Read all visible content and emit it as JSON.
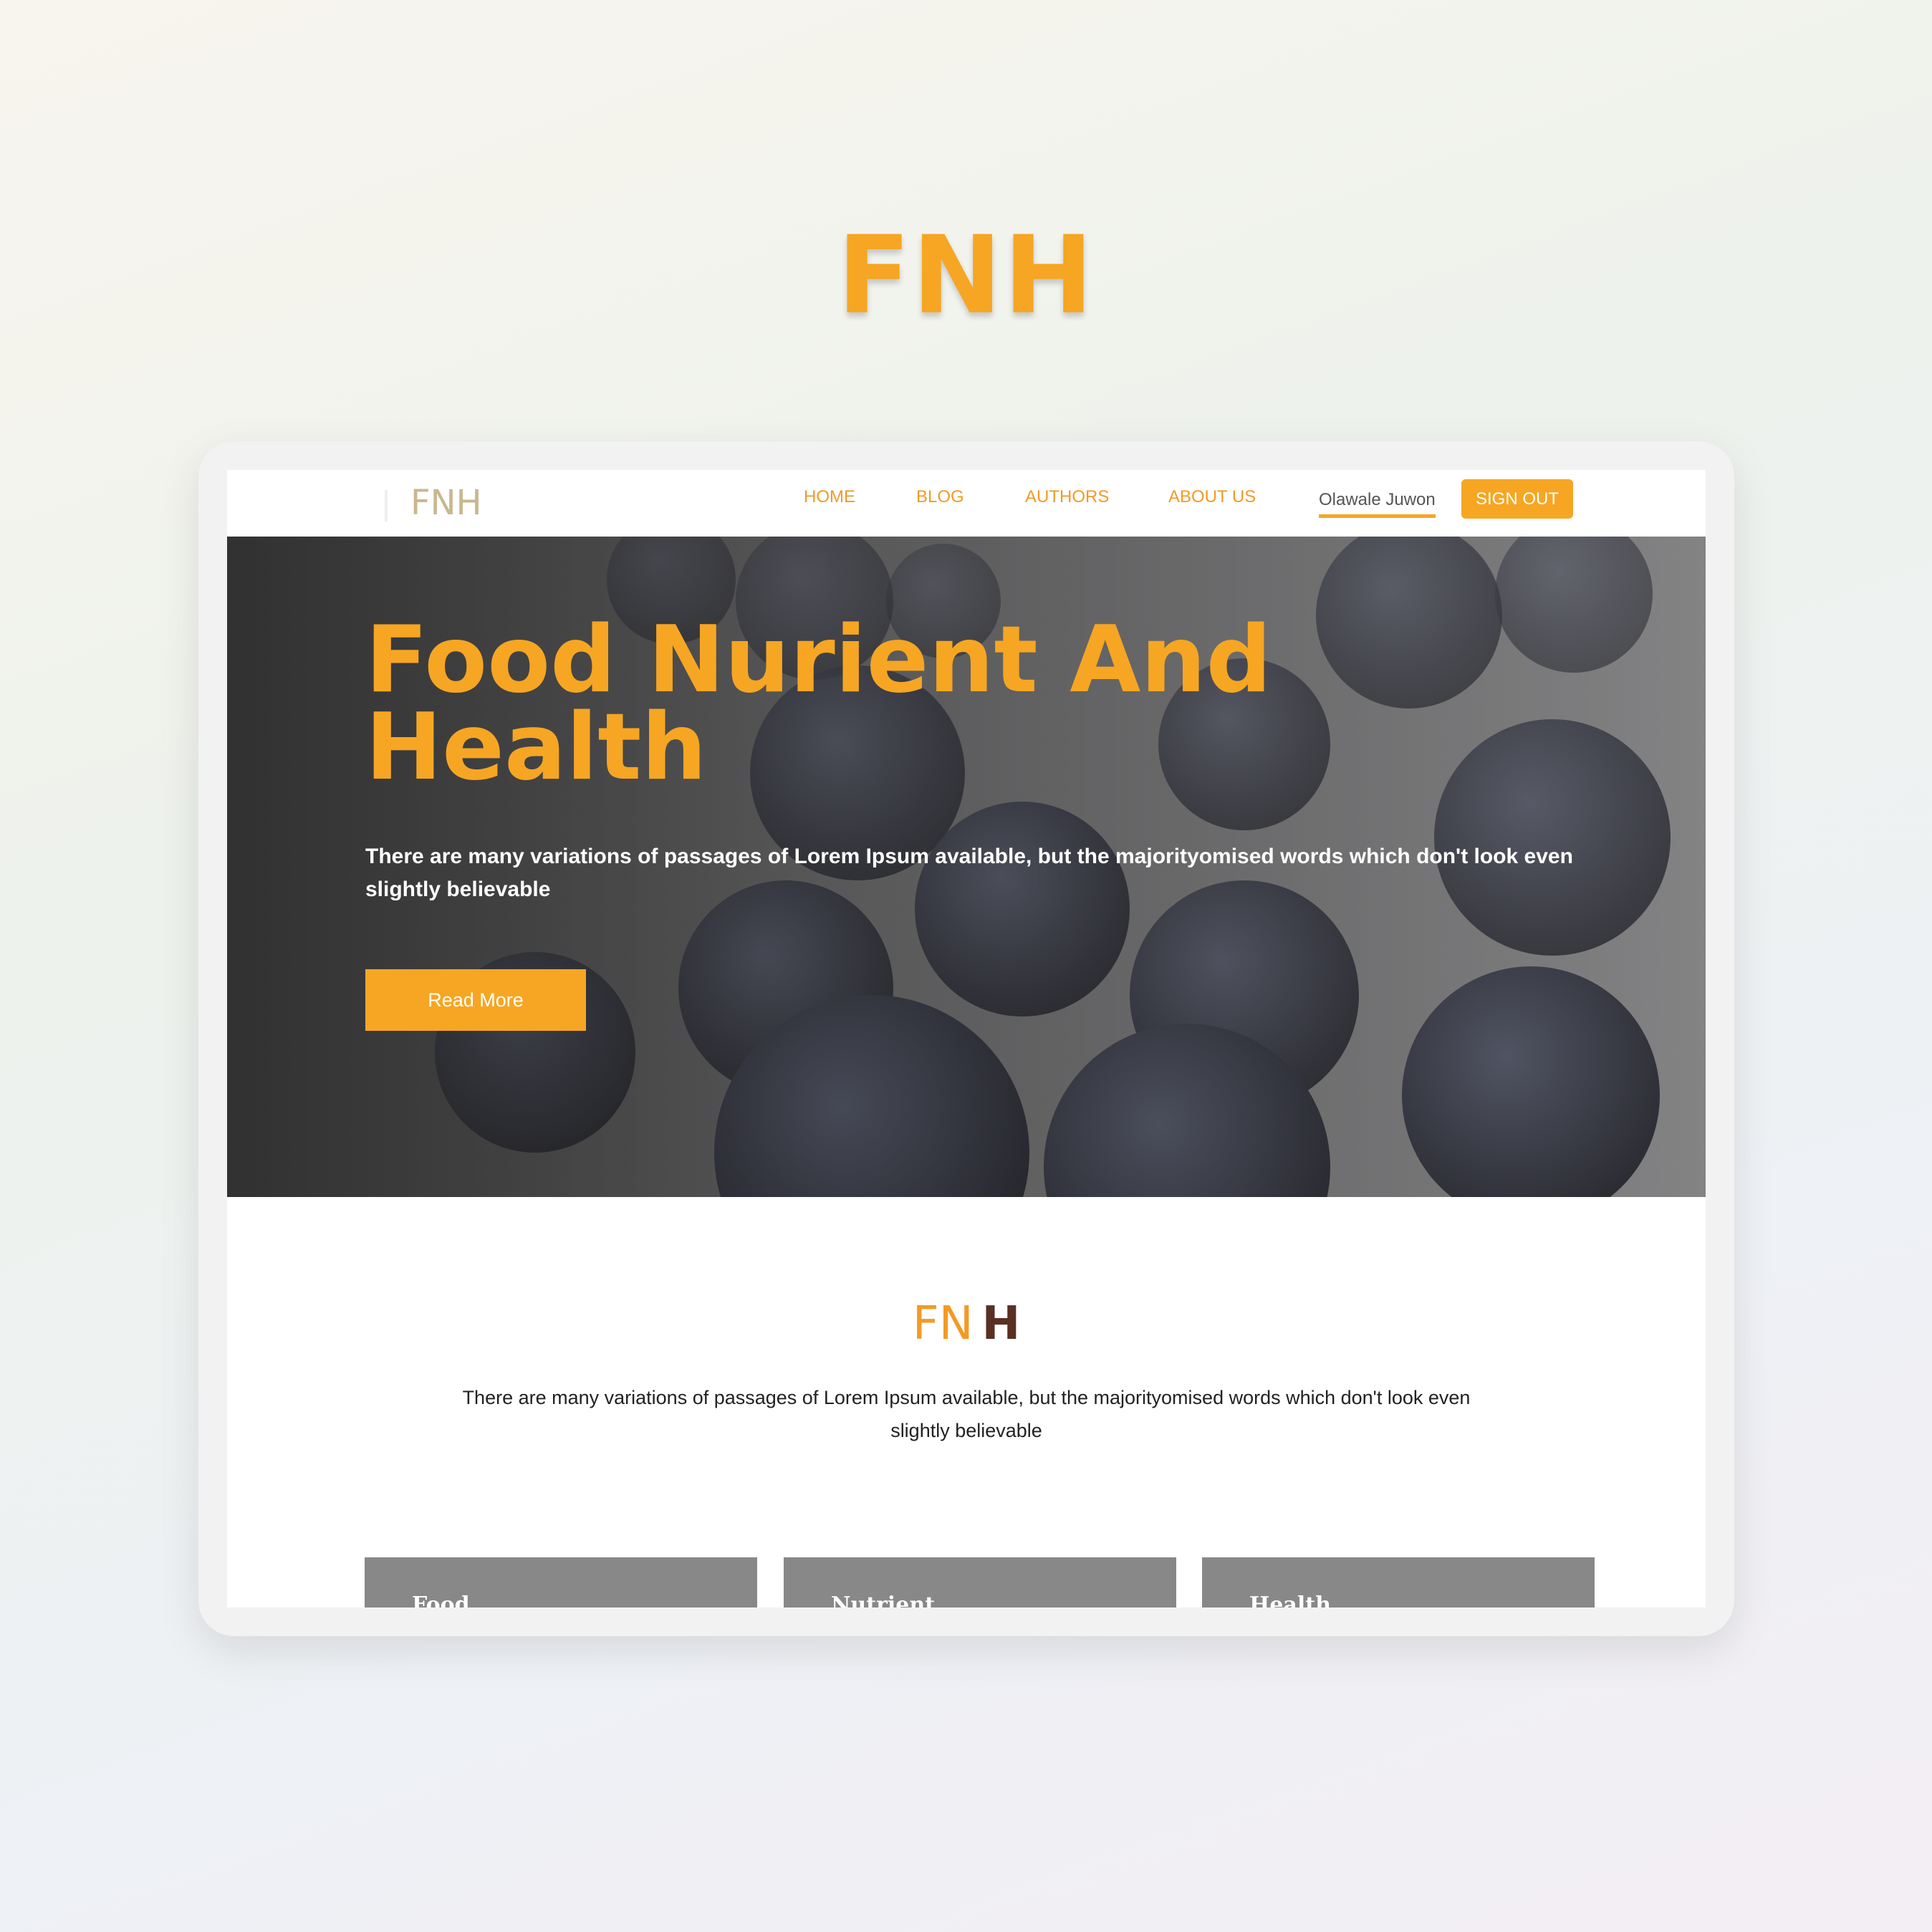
{
  "showcase_title": "FNH",
  "navbar": {
    "logo": "FNH",
    "links": [
      "HOME",
      "BLOG",
      "AUTHORS",
      "ABOUT US"
    ],
    "user_name": "Olawale Juwon",
    "signout_label": "SIGN OUT"
  },
  "hero": {
    "title_line1": "Food Nurient And",
    "title_line2": "Health",
    "text": "There are many variations of passages of Lorem Ipsum available, but the majorityomised words which don't look even slightly believable",
    "button_label": "Read More"
  },
  "intro": {
    "logo_fn": "FN",
    "logo_h": "H",
    "text": "There are many variations of passages of Lorem Ipsum available, but the majorityomised words which don't look even slightly believable"
  },
  "cards": [
    "Food",
    "Nutrient",
    "Health"
  ],
  "colors": {
    "accent": "#f6a623",
    "logo_dark": "#5a2f24",
    "card_bg": "#888888"
  }
}
